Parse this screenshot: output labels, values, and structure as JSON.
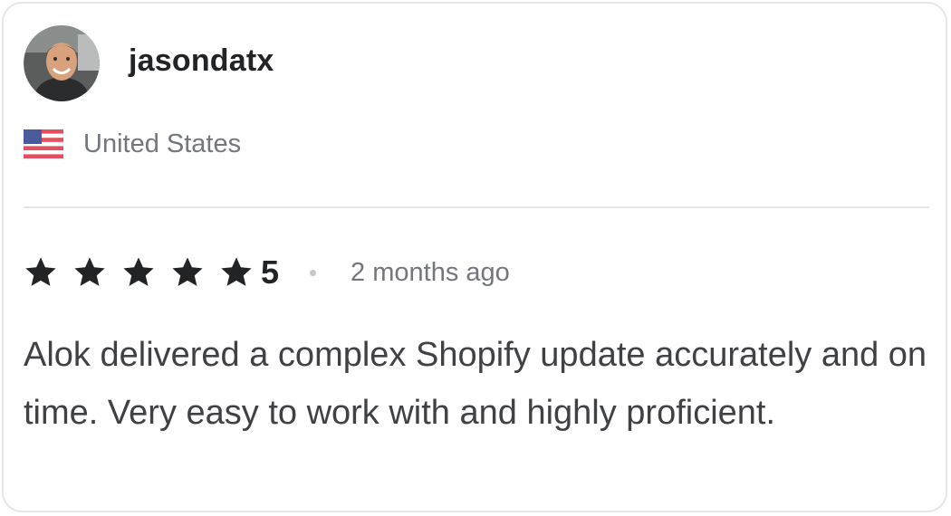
{
  "reviewer": {
    "username": "jasondatx",
    "avatar_icon": "user-avatar-photo",
    "country": "United States",
    "flag_icon": "us-flag-icon"
  },
  "rating": {
    "stars": 5,
    "max_stars": 5,
    "value_label": "5",
    "star_color": "#222325",
    "time_ago": "2 months ago"
  },
  "review": {
    "text": "Alok delivered a complex Shopify update accurately and on time. Very easy to work with and highly proficient."
  }
}
